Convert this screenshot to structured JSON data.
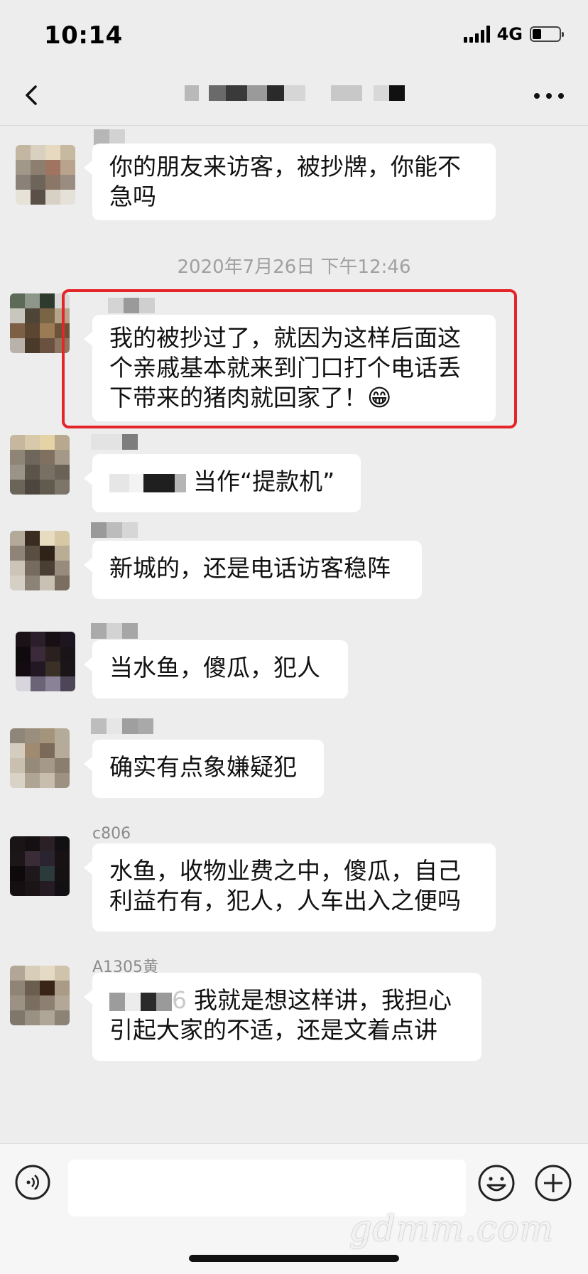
{
  "status_bar": {
    "time": "10:14",
    "network": "4G",
    "battery_level": 0.3
  },
  "nav": {
    "back_icon": "chevron-left-icon",
    "more_icon": "ellipsis-icon"
  },
  "messages": [
    {
      "text_lines": [
        "你的朋友来访客，被抄牌，你能不",
        "急吗"
      ]
    },
    {
      "text_lines": [
        "我的被抄过了，就因为这样后面这",
        "个亲戚基本就来到门口打个电话丢",
        "下带来的猪肉就回家了！"
      ],
      "emoji": "😁"
    },
    {
      "text": "当作“提款机”"
    },
    {
      "text": "新城的，还是电话访客稳阵"
    },
    {
      "text": "当水鱼，傻瓜，犯人"
    },
    {
      "text": "确实有点象嫌疑犯"
    },
    {
      "nickname": "c806",
      "text_lines": [
        "水鱼，收物业费之中，傻瓜，自己",
        "利益冇有，犯人，人车出入之便吗"
      ]
    },
    {
      "nickname": "A1305黄",
      "prefix": "6",
      "text_lines": [
        "我就是想这样讲，我担心",
        "引起大家的不适，还是文着点讲"
      ]
    }
  ],
  "timestamp": "2020年7月26日 下午12:46",
  "colors": {
    "background": "#ededed",
    "bubble": "#ffffff",
    "highlight": "#e4262a"
  },
  "input_bar": {
    "voice_icon": "voice-icon",
    "emoji_icon": "emoji-icon",
    "plus_icon": "plus-icon"
  },
  "watermark": "gdmm.com"
}
